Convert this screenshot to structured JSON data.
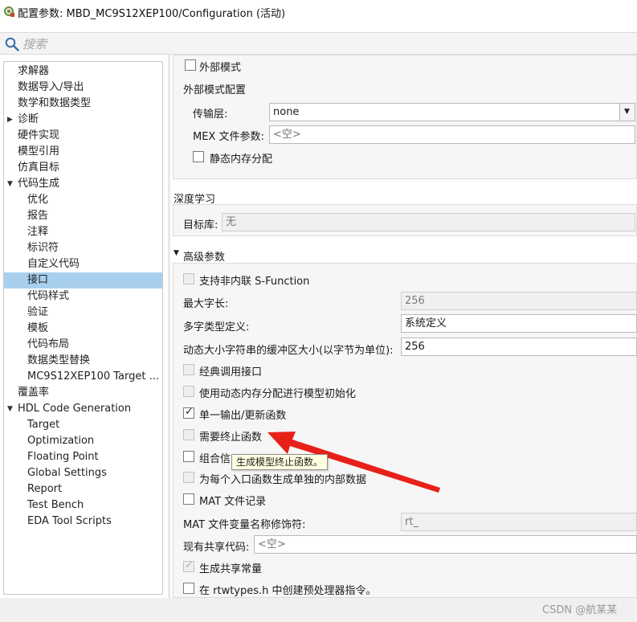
{
  "window": {
    "title": "配置参数: MBD_MC9S12XEP100/Configuration (活动)",
    "icon": "config-gear-icon"
  },
  "search": {
    "placeholder": "搜索",
    "icon": "search-icon"
  },
  "tree": {
    "items": [
      {
        "label": "求解器"
      },
      {
        "label": "数据导入/导出"
      },
      {
        "label": "数学和数据类型"
      },
      {
        "label": "诊断",
        "expander": "▶"
      },
      {
        "label": "硬件实现"
      },
      {
        "label": "模型引用"
      },
      {
        "label": "仿真目标"
      },
      {
        "label": "代码生成",
        "expander": "▼"
      },
      {
        "label": "优化"
      },
      {
        "label": "报告"
      },
      {
        "label": "注释"
      },
      {
        "label": "标识符"
      },
      {
        "label": "自定义代码"
      },
      {
        "label": "接口",
        "selected": true
      },
      {
        "label": "代码样式"
      },
      {
        "label": "验证"
      },
      {
        "label": "模板"
      },
      {
        "label": "代码布局"
      },
      {
        "label": "数据类型替换"
      },
      {
        "label": "MC9S12XEP100 Target ..."
      },
      {
        "label": "覆盖率"
      },
      {
        "label": "HDL Code Generation",
        "expander": "▼"
      },
      {
        "label": "Target"
      },
      {
        "label": "Optimization"
      },
      {
        "label": "Floating Point"
      },
      {
        "label": "Global Settings"
      },
      {
        "label": "Report"
      },
      {
        "label": "Test Bench"
      },
      {
        "label": "EDA Tool Scripts"
      }
    ]
  },
  "external_mode": {
    "checkbox_label": "外部模式",
    "config_title": "外部模式配置",
    "transport_label": "传输层:",
    "transport_value": "none",
    "mex_label": "MEX 文件参数:",
    "mex_placeholder": "<空>",
    "static_mem_label": "静态内存分配"
  },
  "deep_learning": {
    "title": "深度学习",
    "target_lib_label": "目标库:",
    "target_lib_value": "无"
  },
  "advanced": {
    "title": "高级参数",
    "expander": "▼",
    "support_noninlined_label": "支持非内联 S-Function",
    "max_word_len_label": "最大字长:",
    "max_word_len_value": "256",
    "multiword_label": "多字类型定义:",
    "multiword_value": "系统定义",
    "dyn_buffer_label": "动态大小字符串的缓冲区大小(以字节为单位):",
    "dyn_buffer_value": "256",
    "classic_call_label": "经典调用接口",
    "dyn_mem_init_label": "使用动态内存分配进行模型初始化",
    "single_output_label": "单一输出/更新函数",
    "single_output_checked": true,
    "terminate_label": "需要终止函数",
    "combine_label": "组合信",
    "separate_data_label": "为每个入口函数生成单独的内部数据",
    "mat_logging_label": "MAT 文件记录",
    "mat_modifier_label": "MAT 文件变量名称修饰符:",
    "mat_modifier_value": "rt_",
    "shared_code_label": "现有共享代码:",
    "shared_code_placeholder": "<空>",
    "gen_shared_const_label": "生成共享常量",
    "gen_shared_const_checked": true,
    "rtwtypes_label": "在 rtwtypes.h 中创建预处理器指令。"
  },
  "tooltip": {
    "text": "生成模型终止函数。"
  },
  "annotation": {
    "arrow_color": "#e8201a"
  },
  "watermark": {
    "text": "CSDN @航某某"
  }
}
